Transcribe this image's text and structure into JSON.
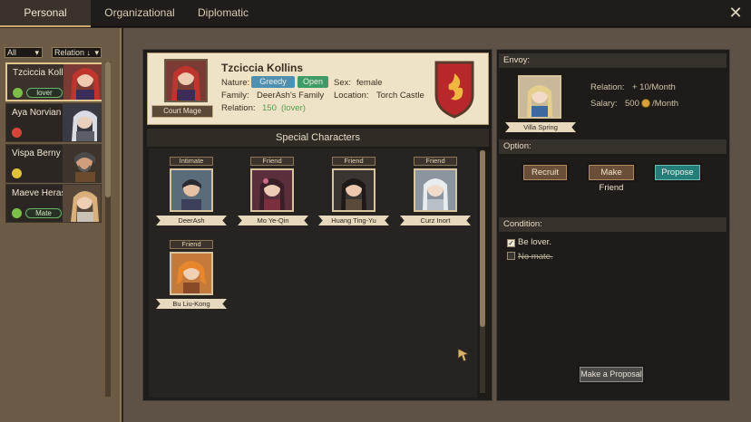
{
  "tabs": [
    "Personal",
    "Organizational",
    "Diplomatic"
  ],
  "filters": {
    "all": "All",
    "relation": "Relation ↓"
  },
  "characters": [
    {
      "name": "Tzciccia Kollins",
      "tag": "lover",
      "mood": "happy"
    },
    {
      "name": "Aya Norvian",
      "tag": "",
      "mood": "angry"
    },
    {
      "name": "Vispa Berny",
      "tag": "",
      "mood": "neutral"
    },
    {
      "name": "Maeve Herason",
      "tag": "Mate",
      "mood": "happy"
    }
  ],
  "selected": {
    "name": "Tzciccia Kollins",
    "title_badge": "Court Mage",
    "nature_label": "Nature:",
    "natures": [
      "Greedy",
      "Open"
    ],
    "sex_label": "Sex:",
    "sex": "female",
    "family_label": "Family:",
    "family": "DeerAsh's Family",
    "location_label": "Location:",
    "location": "Torch Castle",
    "relation_label": "Relation:",
    "relation_value": "150",
    "relation_status": "(lover)"
  },
  "special_title": "Special Characters",
  "special_characters": [
    {
      "relation": "Intimate",
      "name": "DeerAsh"
    },
    {
      "relation": "Friend",
      "name": "Mo Ye-Qin"
    },
    {
      "relation": "Friend",
      "name": "Huang Ting-Yu"
    },
    {
      "relation": "Friend",
      "name": "Curz Inort"
    },
    {
      "relation": "Friend",
      "name": "Bu Liu-Kong"
    }
  ],
  "envoy": {
    "header": "Envoy:",
    "name": "Villa Spring",
    "relation_label": "Relation:",
    "relation_value": "+ 10/Month",
    "salary_label": "Salary:",
    "salary_value": "500",
    "salary_unit": "/Month"
  },
  "option": {
    "header": "Option:",
    "buttons": [
      "Recruit",
      "Make Friend",
      "Propose"
    ]
  },
  "condition": {
    "header": "Condition:",
    "items": [
      {
        "text": "Be lover.",
        "met": true
      },
      {
        "text": "No mate.",
        "met": false
      }
    ]
  },
  "proposal_button": "Make a Proposal",
  "close": "✕",
  "colors": {
    "accent": "#247d78",
    "relation_green": "#4fa04f",
    "greedy": "#4f8fb0",
    "open": "#3e9a66"
  }
}
